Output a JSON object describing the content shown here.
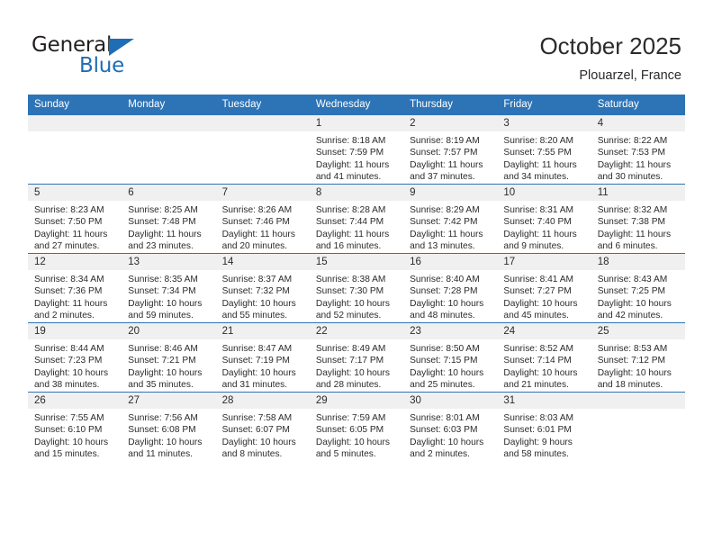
{
  "brand": {
    "name_top": "General",
    "name_bottom": "Blue",
    "accent_color": "#1f6db5"
  },
  "header": {
    "title": "October 2025",
    "subtitle": "Plouarzel, France"
  },
  "theme": {
    "header_blue": "#2d74b7",
    "daynum_band": "#f0f0f0",
    "text": "#2b2b2b"
  },
  "labels": {
    "sunrise_prefix": "Sunrise:",
    "sunset_prefix": "Sunset:",
    "daylight_prefix": "Daylight:"
  },
  "weekday_headers": [
    "Sunday",
    "Monday",
    "Tuesday",
    "Wednesday",
    "Thursday",
    "Friday",
    "Saturday"
  ],
  "weeks": [
    [
      {
        "empty": true
      },
      {
        "empty": true
      },
      {
        "empty": true
      },
      {
        "day": "1",
        "sunrise": "Sunrise: 8:18 AM",
        "sunset": "Sunset: 7:59 PM",
        "daylight_1": "Daylight: 11 hours",
        "daylight_2": "and 41 minutes."
      },
      {
        "day": "2",
        "sunrise": "Sunrise: 8:19 AM",
        "sunset": "Sunset: 7:57 PM",
        "daylight_1": "Daylight: 11 hours",
        "daylight_2": "and 37 minutes."
      },
      {
        "day": "3",
        "sunrise": "Sunrise: 8:20 AM",
        "sunset": "Sunset: 7:55 PM",
        "daylight_1": "Daylight: 11 hours",
        "daylight_2": "and 34 minutes."
      },
      {
        "day": "4",
        "sunrise": "Sunrise: 8:22 AM",
        "sunset": "Sunset: 7:53 PM",
        "daylight_1": "Daylight: 11 hours",
        "daylight_2": "and 30 minutes."
      }
    ],
    [
      {
        "day": "5",
        "sunrise": "Sunrise: 8:23 AM",
        "sunset": "Sunset: 7:50 PM",
        "daylight_1": "Daylight: 11 hours",
        "daylight_2": "and 27 minutes."
      },
      {
        "day": "6",
        "sunrise": "Sunrise: 8:25 AM",
        "sunset": "Sunset: 7:48 PM",
        "daylight_1": "Daylight: 11 hours",
        "daylight_2": "and 23 minutes."
      },
      {
        "day": "7",
        "sunrise": "Sunrise: 8:26 AM",
        "sunset": "Sunset: 7:46 PM",
        "daylight_1": "Daylight: 11 hours",
        "daylight_2": "and 20 minutes."
      },
      {
        "day": "8",
        "sunrise": "Sunrise: 8:28 AM",
        "sunset": "Sunset: 7:44 PM",
        "daylight_1": "Daylight: 11 hours",
        "daylight_2": "and 16 minutes."
      },
      {
        "day": "9",
        "sunrise": "Sunrise: 8:29 AM",
        "sunset": "Sunset: 7:42 PM",
        "daylight_1": "Daylight: 11 hours",
        "daylight_2": "and 13 minutes."
      },
      {
        "day": "10",
        "sunrise": "Sunrise: 8:31 AM",
        "sunset": "Sunset: 7:40 PM",
        "daylight_1": "Daylight: 11 hours",
        "daylight_2": "and 9 minutes."
      },
      {
        "day": "11",
        "sunrise": "Sunrise: 8:32 AM",
        "sunset": "Sunset: 7:38 PM",
        "daylight_1": "Daylight: 11 hours",
        "daylight_2": "and 6 minutes."
      }
    ],
    [
      {
        "day": "12",
        "sunrise": "Sunrise: 8:34 AM",
        "sunset": "Sunset: 7:36 PM",
        "daylight_1": "Daylight: 11 hours",
        "daylight_2": "and 2 minutes."
      },
      {
        "day": "13",
        "sunrise": "Sunrise: 8:35 AM",
        "sunset": "Sunset: 7:34 PM",
        "daylight_1": "Daylight: 10 hours",
        "daylight_2": "and 59 minutes."
      },
      {
        "day": "14",
        "sunrise": "Sunrise: 8:37 AM",
        "sunset": "Sunset: 7:32 PM",
        "daylight_1": "Daylight: 10 hours",
        "daylight_2": "and 55 minutes."
      },
      {
        "day": "15",
        "sunrise": "Sunrise: 8:38 AM",
        "sunset": "Sunset: 7:30 PM",
        "daylight_1": "Daylight: 10 hours",
        "daylight_2": "and 52 minutes."
      },
      {
        "day": "16",
        "sunrise": "Sunrise: 8:40 AM",
        "sunset": "Sunset: 7:28 PM",
        "daylight_1": "Daylight: 10 hours",
        "daylight_2": "and 48 minutes."
      },
      {
        "day": "17",
        "sunrise": "Sunrise: 8:41 AM",
        "sunset": "Sunset: 7:27 PM",
        "daylight_1": "Daylight: 10 hours",
        "daylight_2": "and 45 minutes."
      },
      {
        "day": "18",
        "sunrise": "Sunrise: 8:43 AM",
        "sunset": "Sunset: 7:25 PM",
        "daylight_1": "Daylight: 10 hours",
        "daylight_2": "and 42 minutes."
      }
    ],
    [
      {
        "day": "19",
        "sunrise": "Sunrise: 8:44 AM",
        "sunset": "Sunset: 7:23 PM",
        "daylight_1": "Daylight: 10 hours",
        "daylight_2": "and 38 minutes."
      },
      {
        "day": "20",
        "sunrise": "Sunrise: 8:46 AM",
        "sunset": "Sunset: 7:21 PM",
        "daylight_1": "Daylight: 10 hours",
        "daylight_2": "and 35 minutes."
      },
      {
        "day": "21",
        "sunrise": "Sunrise: 8:47 AM",
        "sunset": "Sunset: 7:19 PM",
        "daylight_1": "Daylight: 10 hours",
        "daylight_2": "and 31 minutes."
      },
      {
        "day": "22",
        "sunrise": "Sunrise: 8:49 AM",
        "sunset": "Sunset: 7:17 PM",
        "daylight_1": "Daylight: 10 hours",
        "daylight_2": "and 28 minutes."
      },
      {
        "day": "23",
        "sunrise": "Sunrise: 8:50 AM",
        "sunset": "Sunset: 7:15 PM",
        "daylight_1": "Daylight: 10 hours",
        "daylight_2": "and 25 minutes."
      },
      {
        "day": "24",
        "sunrise": "Sunrise: 8:52 AM",
        "sunset": "Sunset: 7:14 PM",
        "daylight_1": "Daylight: 10 hours",
        "daylight_2": "and 21 minutes."
      },
      {
        "day": "25",
        "sunrise": "Sunrise: 8:53 AM",
        "sunset": "Sunset: 7:12 PM",
        "daylight_1": "Daylight: 10 hours",
        "daylight_2": "and 18 minutes."
      }
    ],
    [
      {
        "day": "26",
        "sunrise": "Sunrise: 7:55 AM",
        "sunset": "Sunset: 6:10 PM",
        "daylight_1": "Daylight: 10 hours",
        "daylight_2": "and 15 minutes."
      },
      {
        "day": "27",
        "sunrise": "Sunrise: 7:56 AM",
        "sunset": "Sunset: 6:08 PM",
        "daylight_1": "Daylight: 10 hours",
        "daylight_2": "and 11 minutes."
      },
      {
        "day": "28",
        "sunrise": "Sunrise: 7:58 AM",
        "sunset": "Sunset: 6:07 PM",
        "daylight_1": "Daylight: 10 hours",
        "daylight_2": "and 8 minutes."
      },
      {
        "day": "29",
        "sunrise": "Sunrise: 7:59 AM",
        "sunset": "Sunset: 6:05 PM",
        "daylight_1": "Daylight: 10 hours",
        "daylight_2": "and 5 minutes."
      },
      {
        "day": "30",
        "sunrise": "Sunrise: 8:01 AM",
        "sunset": "Sunset: 6:03 PM",
        "daylight_1": "Daylight: 10 hours",
        "daylight_2": "and 2 minutes."
      },
      {
        "day": "31",
        "sunrise": "Sunrise: 8:03 AM",
        "sunset": "Sunset: 6:01 PM",
        "daylight_1": "Daylight: 9 hours",
        "daylight_2": "and 58 minutes."
      },
      {
        "empty": true
      }
    ]
  ]
}
